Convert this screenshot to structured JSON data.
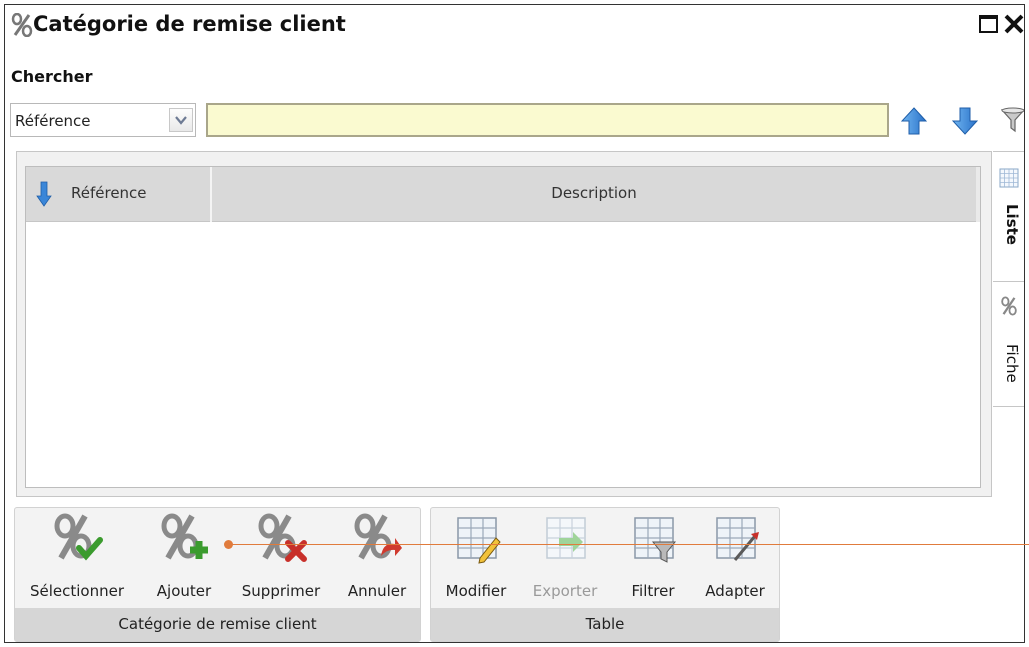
{
  "window": {
    "title": "Catégorie de remise client",
    "title_icon": "percent-icon",
    "maximize_icon": "maximize-icon",
    "close_icon": "close-icon"
  },
  "search": {
    "header": "Chercher",
    "field_selected": "Référence",
    "input_value": "",
    "sort_up_icon": "arrow-up-icon",
    "sort_down_icon": "arrow-down-icon",
    "filter_icon": "filter-icon"
  },
  "grid": {
    "columns": [
      {
        "label": "Référence",
        "sort": "descending"
      },
      {
        "label": "Description"
      }
    ],
    "rows": []
  },
  "side_tabs": [
    {
      "label": "Liste",
      "icon": "grid-icon",
      "active": true
    },
    {
      "label": "Fiche",
      "icon": "percent-icon",
      "active": false
    }
  ],
  "ribbon": {
    "groups": [
      {
        "title": "Catégorie de remise client",
        "buttons": [
          {
            "label": "Sélectionner",
            "icon": "percent-check-icon",
            "enabled": true
          },
          {
            "label": "Ajouter",
            "icon": "percent-add-icon",
            "enabled": true
          },
          {
            "label": "Supprimer",
            "icon": "percent-delete-icon",
            "enabled": true
          },
          {
            "label": "Annuler",
            "icon": "percent-undo-icon",
            "enabled": true
          }
        ]
      },
      {
        "title": "Table",
        "buttons": [
          {
            "label": "Modifier",
            "icon": "table-edit-icon",
            "enabled": true
          },
          {
            "label": "Exporter",
            "icon": "table-export-icon",
            "enabled": false
          },
          {
            "label": "Filtrer",
            "icon": "table-filter-icon",
            "enabled": true
          },
          {
            "label": "Adapter",
            "icon": "table-adapt-icon",
            "enabled": true
          }
        ]
      }
    ]
  },
  "colors": {
    "search_input_bg": "#fafad0",
    "header_bg": "#d9d9d9",
    "arrow_blue": "#3a86d8",
    "annotation": "#e07b3c"
  }
}
